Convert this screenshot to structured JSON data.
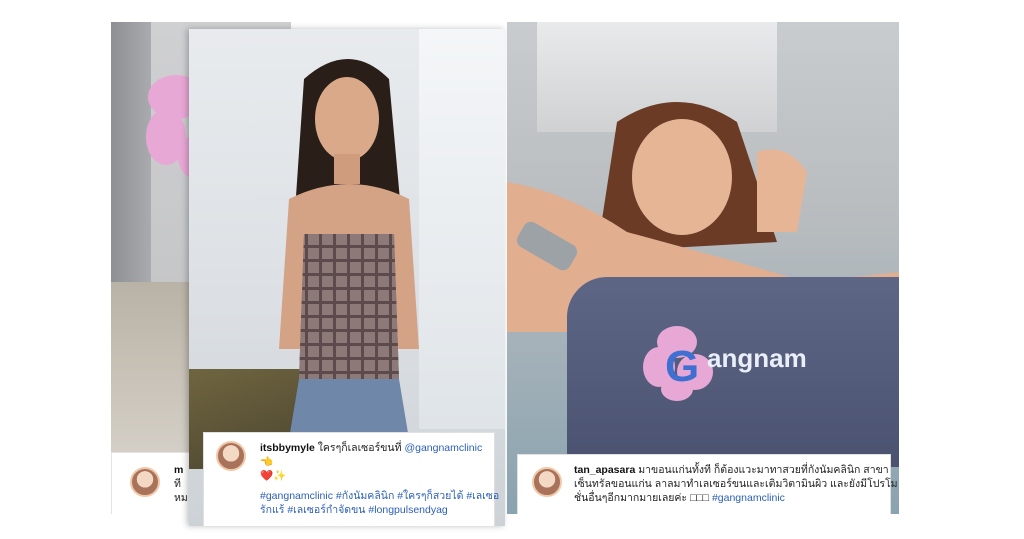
{
  "posts": [
    {
      "username": "m",
      "lines": [
        "ที",
        "หม"
      ]
    },
    {
      "username": "itsbbymyle",
      "text": "ใครๆก็เลเซอร์ขนที่",
      "mention": "@gangnamclinic",
      "emoji_line": "❤️✨",
      "hashtags_line1": "#gangnamclinic #กังนัมคลินิก #ใครๆก็สวยได้ #เลเซอ",
      "hashtags_line2a": "รักแร้ #เลเซอร์กำจัดขน",
      "hashtags_line2b": "#longpulsendyag"
    },
    {
      "username": "tan_apasara",
      "line1": "มาขอนแก่นทั้งที ก็ต้องแวะมาทาสวยที่กังนัมคลินิก สาขา",
      "line2": "เซ็นทรัลขอนแก่น ลาลมาทำเลเซอร์ขนและเติมวิตามินผิว และยังมีโปรโม",
      "line3": "ชั่นอื่นๆอีกมากมายเลยค่ะ",
      "line3_hashtag": "#gangnamclinic",
      "towel_logo": "Gangnam"
    }
  ],
  "colors": {
    "accent_link": "#2c5fb8",
    "flower_pink": "#e8a8d6",
    "logo_blue": "#3f6fd0"
  }
}
